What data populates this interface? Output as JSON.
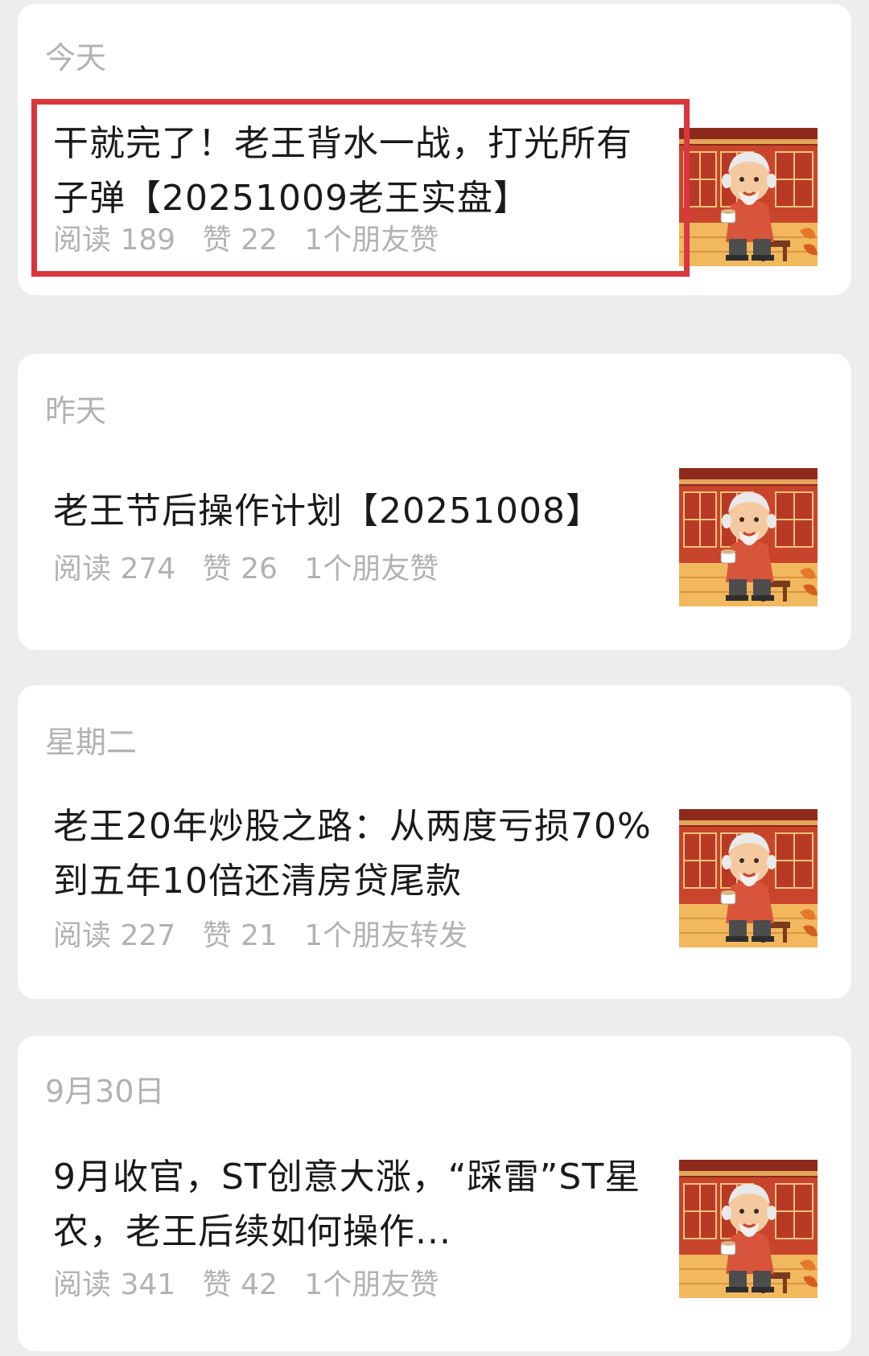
{
  "articles": [
    {
      "date": "今天",
      "title_line1": "干就完了！老王背水一战，打光所有",
      "title_line2": "子弹【20251009老王实盘】",
      "reads": "阅读 189",
      "likes": "赞 22",
      "social": "1个朋友赞",
      "thumbnail_icon": "old-man-drinking-tea-thumbnail"
    },
    {
      "date": "昨天",
      "title_line1": "老王节后操作计划【20251008】",
      "reads": "阅读 274",
      "likes": "赞 26",
      "social": "1个朋友赞",
      "thumbnail_icon": "old-man-drinking-tea-thumbnail"
    },
    {
      "date": "星期二",
      "title_line1": "老王20年炒股之路：从两度亏损70%",
      "title_line2": "到五年10倍还清房贷尾款",
      "reads": "阅读 227",
      "likes": "赞 21",
      "social": "1个朋友转发",
      "thumbnail_icon": "old-man-drinking-tea-thumbnail"
    },
    {
      "date": "9月30日",
      "title_line1": "9月收官，ST创意大涨，“踩雷”ST星",
      "title_line2": "农，老王后续如何操作...",
      "reads": "阅读 341",
      "likes": "赞 42",
      "social": "1个朋友赞",
      "thumbnail_icon": "old-man-drinking-tea-thumbnail"
    }
  ],
  "colors": {
    "background": "#ededed",
    "card": "#ffffff",
    "title_text": "#1a1a1a",
    "secondary_text": "#b2b2b2",
    "highlight_border": "#d9363e"
  }
}
